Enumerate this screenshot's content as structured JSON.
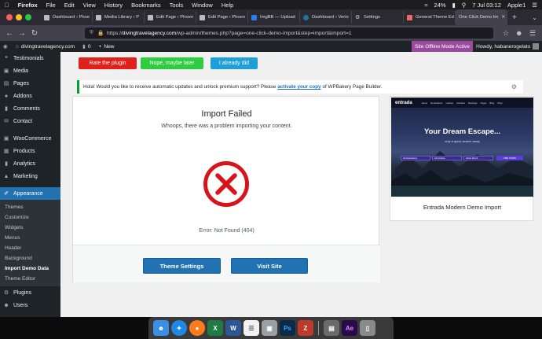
{
  "menubar": {
    "app": "Firefox",
    "items": [
      "File",
      "Edit",
      "View",
      "History",
      "Bookmarks",
      "Tools",
      "Window",
      "Help"
    ],
    "battery": "24%",
    "datetime": "7 Jul  03:12",
    "user": "Apple1"
  },
  "tabs": [
    {
      "label": "Dashboard ‹ Phoe",
      "icon": "wordpress-icon"
    },
    {
      "label": "Media Library ‹ P",
      "icon": "wordpress-icon"
    },
    {
      "label": "Edit Page ‹ Phoen",
      "icon": "wordpress-icon"
    },
    {
      "label": "Edit Page ‹ Phoen",
      "icon": "wordpress-icon"
    },
    {
      "label": "ImgBB — Upload",
      "icon": "imgbb-icon"
    },
    {
      "label": "Dashboard ‹ Verio",
      "icon": "wordpress-icon"
    },
    {
      "label": "Settings",
      "icon": "gear-icon"
    },
    {
      "label": "General Theme Ed",
      "icon": "theme-icon"
    },
    {
      "label": "One Click Demo Im",
      "icon": "wordpress-icon"
    }
  ],
  "url": {
    "prefix": "https://",
    "host": "divingtravelagency.com",
    "path": "/wp-admin/themes.php?page=one-click-demo-import&step=import&import=1"
  },
  "adminbar": {
    "site": "divingtravelagency.com",
    "comments": "0",
    "new": "New",
    "offline": "Site Offline Mode Active",
    "howdy": "Howdy, habanerogelato"
  },
  "sidebar": {
    "items_top": [
      {
        "label": "Testimonials",
        "icon": "testimonial-icon"
      },
      {
        "label": "Media",
        "icon": "media-icon"
      },
      {
        "label": "Pages",
        "icon": "pages-icon"
      },
      {
        "label": "Addons",
        "icon": "addons-icon"
      },
      {
        "label": "Comments",
        "icon": "comments-icon"
      },
      {
        "label": "Contact",
        "icon": "contact-icon"
      }
    ],
    "items_mid": [
      {
        "label": "WooCommerce",
        "icon": "woocommerce-icon"
      },
      {
        "label": "Products",
        "icon": "products-icon"
      },
      {
        "label": "Analytics",
        "icon": "analytics-icon"
      },
      {
        "label": "Marketing",
        "icon": "marketing-icon"
      }
    ],
    "current": "Appearance",
    "submenu": [
      "Themes",
      "Customize",
      "Widgets",
      "Menus",
      "Header",
      "Background",
      "Import Demo Data",
      "Theme Editor"
    ],
    "submenu_active": "Import Demo Data",
    "items_bottom": [
      {
        "label": "Plugins",
        "icon": "plugins-icon"
      },
      {
        "label": "Users",
        "icon": "users-icon"
      }
    ]
  },
  "top_buttons": {
    "rate": "Rate the plugin",
    "later": "Nope, maybe later",
    "did": "I already did",
    "colors": {
      "rate": "#e0201c",
      "later": "#2ecc40",
      "did": "#1e9fd8"
    }
  },
  "notice": {
    "text_before": "Hola! Would you like to receive automatic updates and unlock premium support? Please",
    "link": "activate your copy",
    "text_after": "of WPBakery Page Builder."
  },
  "import": {
    "title": "Import Failed",
    "subtitle": "Whoops, there was a problem importing your content.",
    "error": "Error: Not Found (404)",
    "theme_settings": "Theme Settings",
    "visit_site": "Visit Site",
    "error_color": "#d7141a"
  },
  "demo": {
    "title": "Entrada Modern Demo Import",
    "preview": {
      "logo": "entrada",
      "nav": [
        "Home",
        "Destinations",
        "Listings",
        "Activities",
        "Bookings",
        "Pages",
        "Blog",
        "Shop"
      ],
      "headline": "Your Dream Escape...",
      "tagline": "only a quick search away",
      "fields": [
        "All Destinations",
        "All Activities",
        "Select Month"
      ],
      "button": "FIND TOURS"
    }
  },
  "dock": [
    "finder-icon",
    "safari-icon",
    "firefox-icon",
    "excel-icon",
    "word-icon",
    "notes-icon",
    "preview-icon",
    "photoshop-icon",
    "filezilla-icon",
    "photos-icon",
    "aftereffects-icon",
    "trash-icon"
  ]
}
